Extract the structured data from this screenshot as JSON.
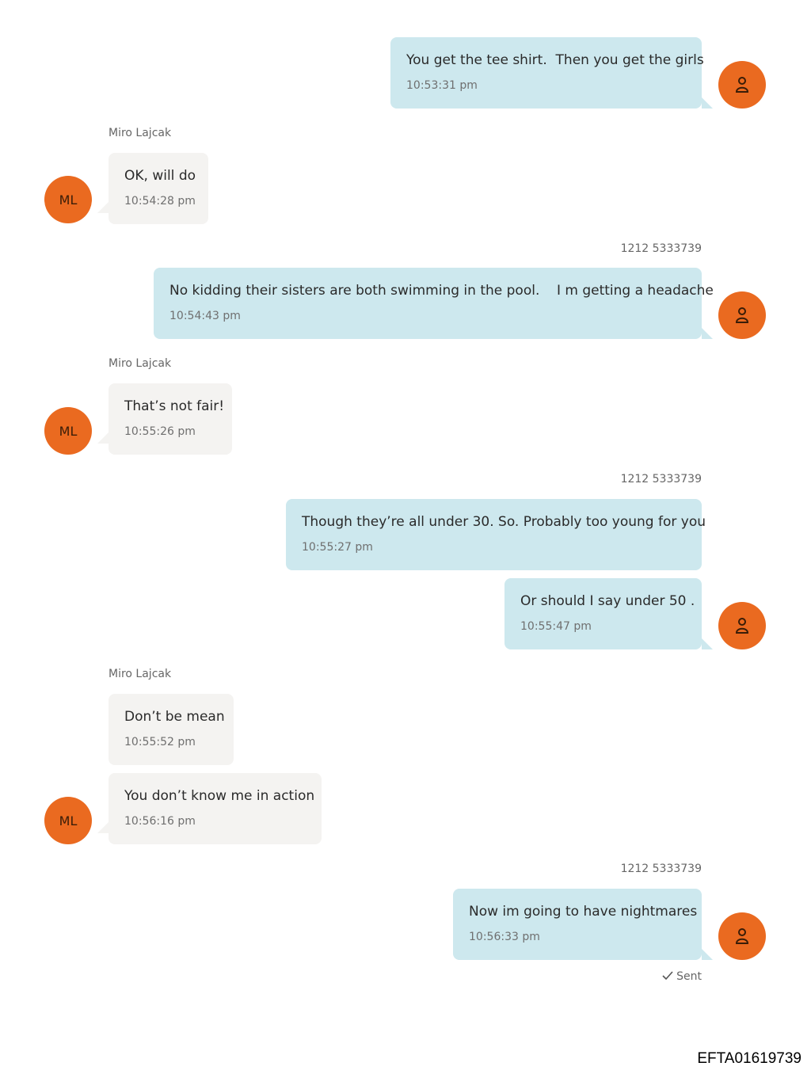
{
  "messages": [
    {
      "text": "You get the tee shirt.  Then you get the girls",
      "time": "10:53:31 pm"
    },
    {
      "sender": "Miro Lajcak",
      "text": "OK, will do",
      "time": "10:54:28 pm"
    },
    {
      "sender": "1212 5333739",
      "text": "No kidding their sisters are both swimming in the pool.    I m getting a headache",
      "time": "10:54:43 pm"
    },
    {
      "sender": "Miro Lajcak",
      "text": "That’s not fair!",
      "time": "10:55:26 pm"
    },
    {
      "sender": "1212 5333739",
      "text": "Though they’re all under 30. So. Probably too young for you",
      "time": "10:55:27 pm"
    },
    {
      "text": "Or should I say under 50 .",
      "time": "10:55:47 pm"
    },
    {
      "sender": "Miro Lajcak",
      "text": "Don’t be mean",
      "time": "10:55:52 pm"
    },
    {
      "text": "You don’t know me in action",
      "time": "10:56:16 pm"
    },
    {
      "sender": "1212 5333739",
      "text": "Now im going to have nightmares",
      "time": "10:56:33 pm"
    }
  ],
  "avatars": {
    "incoming_initials": "ML"
  },
  "status": {
    "sent_label": "Sent"
  },
  "footer": {
    "doc_id": "EFTA01619739"
  },
  "colors": {
    "outgoing_bubble": "#cde8ee",
    "incoming_bubble": "#f4f3f1",
    "avatar": "#ea6a20"
  }
}
